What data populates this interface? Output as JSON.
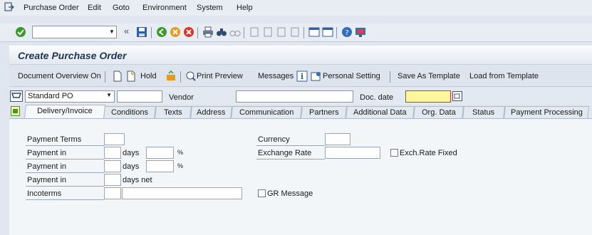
{
  "menu": {
    "items": [
      "Purchase Order",
      "Edit",
      "Goto",
      "Environment",
      "System",
      "Help"
    ]
  },
  "toolbar": {
    "command_value": ""
  },
  "title": "Create Purchase Order",
  "app_toolbar": {
    "doc_overview": "Document Overview On",
    "hold": "Hold",
    "print_preview": "Print Preview",
    "messages": "Messages",
    "personal_setting": "Personal Setting",
    "save_template": "Save As Template",
    "load_template": "Load from Template"
  },
  "header": {
    "doc_type": "Standard PO",
    "po_number": "",
    "vendor_label": "Vendor",
    "vendor_value": "",
    "doc_date_label": "Doc. date",
    "doc_date_value": ""
  },
  "tabs": [
    "Delivery/Invoice",
    "Conditions",
    "Texts",
    "Address",
    "Communication",
    "Partners",
    "Additional Data",
    "Org. Data",
    "Status",
    "Payment Processing"
  ],
  "active_tab": "Delivery/Invoice",
  "form": {
    "payment_terms": "Payment Terms",
    "payment_in": "Payment in",
    "days": "days",
    "percent": "%",
    "days_net": "days net",
    "incoterms": "Incoterms",
    "currency": "Currency",
    "exchange_rate": "Exchange Rate",
    "exch_fixed": "Exch.Rate Fixed",
    "gr_message": "GR Message"
  },
  "colors": {
    "accent": "#1f3552",
    "date_field": "#fff59d",
    "error_marker": "#d9352a",
    "check_green": "#3a9a2a"
  }
}
